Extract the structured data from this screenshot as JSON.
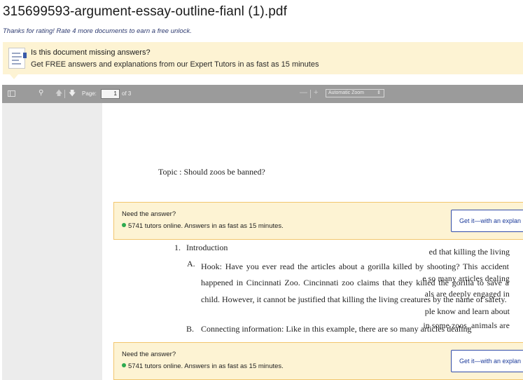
{
  "document": {
    "title": "315699593-argument-essay-outline-fianl (1).pdf",
    "rating_note": "Thanks for rating! Rate 4 more documents to earn a free unlock."
  },
  "missing_banner": {
    "title": "Is this document missing answers?",
    "subtitle": "Get FREE answers and explanations from our Expert Tutors in as fast as 15 minutes",
    "icon": "document-icon"
  },
  "viewer_toolbar": {
    "page_label": "Page:",
    "page_value": "1",
    "page_count": "of 3",
    "zoom_value": "Automatic Zoom",
    "minus": "—",
    "plus": "+",
    "icons": [
      "sidebar-toggle-icon",
      "search-icon",
      "arrow-up-icon",
      "arrow-down-icon",
      "zoom-out-icon",
      "zoom-in-icon"
    ]
  },
  "pdf_page": {
    "topic": "Topic : Should zoos be banned?",
    "intro_number": "1.",
    "intro_label": "Introduction",
    "a_label": "A.",
    "a_text": "Hook: Have you ever read the articles about a gorilla killed by shooting? This accident happened in Cincinnati Zoo. Cincinnati zoo claims that they killed the gorilla to save a child. However, it cannot be justified that killing the living creatures by the name of safety.",
    "b_label": "B.",
    "b_text": "Connecting information: Like in this example, there are so many articles dealing",
    "ghost_lines": [
      "ed that killing the living",
      "e so many articles dealing",
      "als are deeply engaged in",
      "ple know and learn about",
      "in some zoos, animals are"
    ]
  },
  "answer_cards": [
    {
      "question": "Need the answer?",
      "online": "5741 tutors online. Answers in as fast as 15 minutes.",
      "button": "Get it—with an explan"
    },
    {
      "question": "Need the answer?",
      "online": "5741 tutors online. Answers in as fast as 15 minutes.",
      "button": "Get it—with an explan"
    }
  ],
  "colors": {
    "banner_bg": "#fdf3d3",
    "card_border": "#f2c66e",
    "button_border": "#2f4aa8",
    "online_dot": "#2daa4f",
    "toolbar_bg": "#9b9b9b"
  }
}
